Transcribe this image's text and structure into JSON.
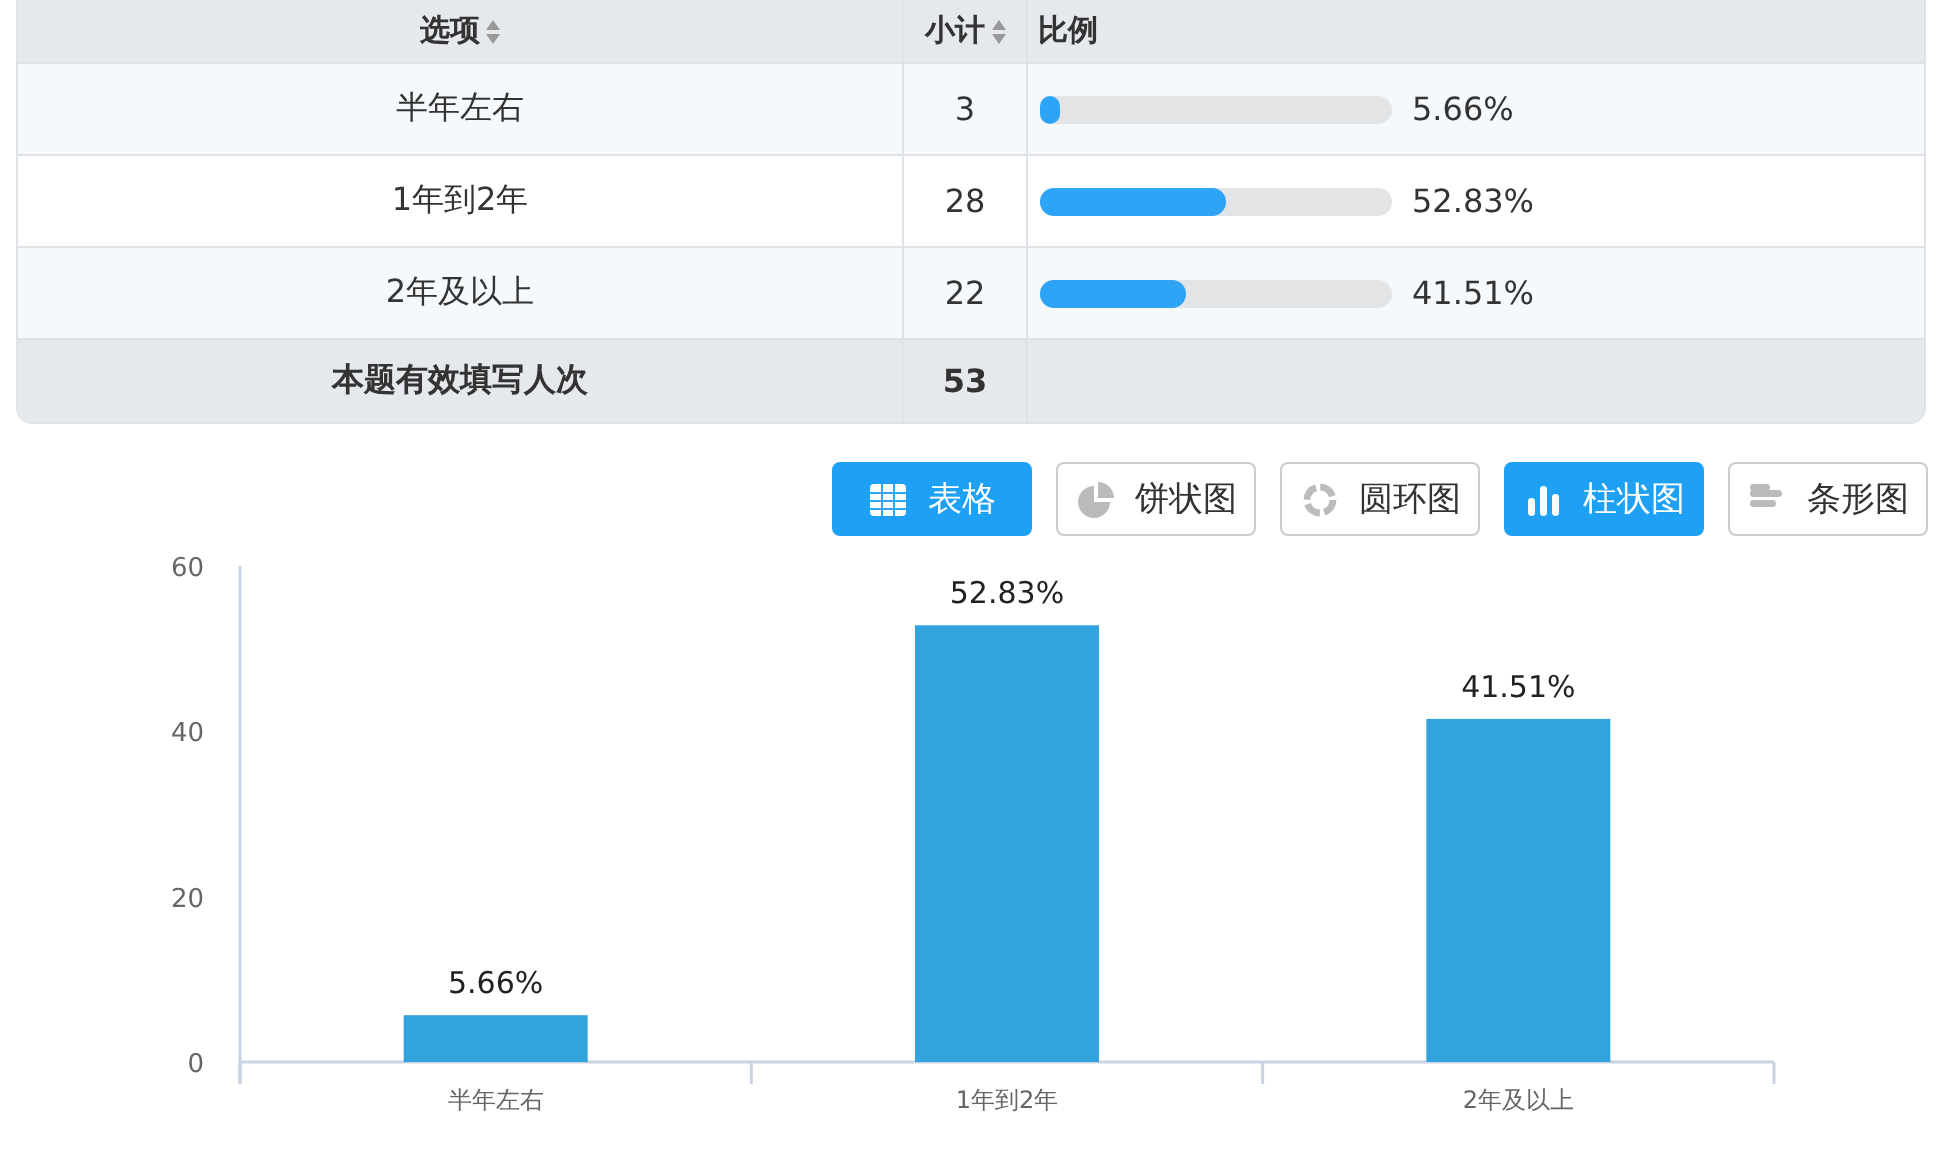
{
  "table": {
    "columns": [
      {
        "label": "选项",
        "sortable": true
      },
      {
        "label": "小计",
        "sortable": true
      },
      {
        "label": "比例",
        "sortable": false
      }
    ],
    "rows": [
      {
        "option": "半年左右",
        "count": "3",
        "level": 0.0566,
        "percent": "5.66%"
      },
      {
        "option": "1年到2年",
        "count": "28",
        "level": 0.5283,
        "percent": "52.83%"
      },
      {
        "option": "2年及以上",
        "count": "22",
        "level": 0.4151,
        "percent": "41.51%"
      }
    ],
    "total": {
      "label": "本题有效填写人次",
      "count": "53"
    }
  },
  "view_buttons": [
    {
      "kind": "table",
      "label": "表格",
      "selected": true
    },
    {
      "kind": "pie",
      "label": "饼状图",
      "selected": false
    },
    {
      "kind": "donut",
      "label": "圆环图",
      "selected": false
    },
    {
      "kind": "column",
      "label": "柱状图",
      "selected": true
    },
    {
      "kind": "bar",
      "label": "条形图",
      "selected": false
    }
  ],
  "chart": {
    "chart_data": {
      "type": "bar",
      "categories": [
        "半年左右",
        "1年到2年",
        "2年及以上"
      ],
      "series": [
        {
          "color": "#32a3dc",
          "values": [
            5.66,
            52.83,
            41.51
          ]
        }
      ],
      "ylim": [
        0,
        60
      ],
      "yticks": [
        0,
        20,
        40,
        60
      ],
      "value_labels": [
        "5.66%",
        "52.83%",
        "41.51%"
      ]
    }
  }
}
